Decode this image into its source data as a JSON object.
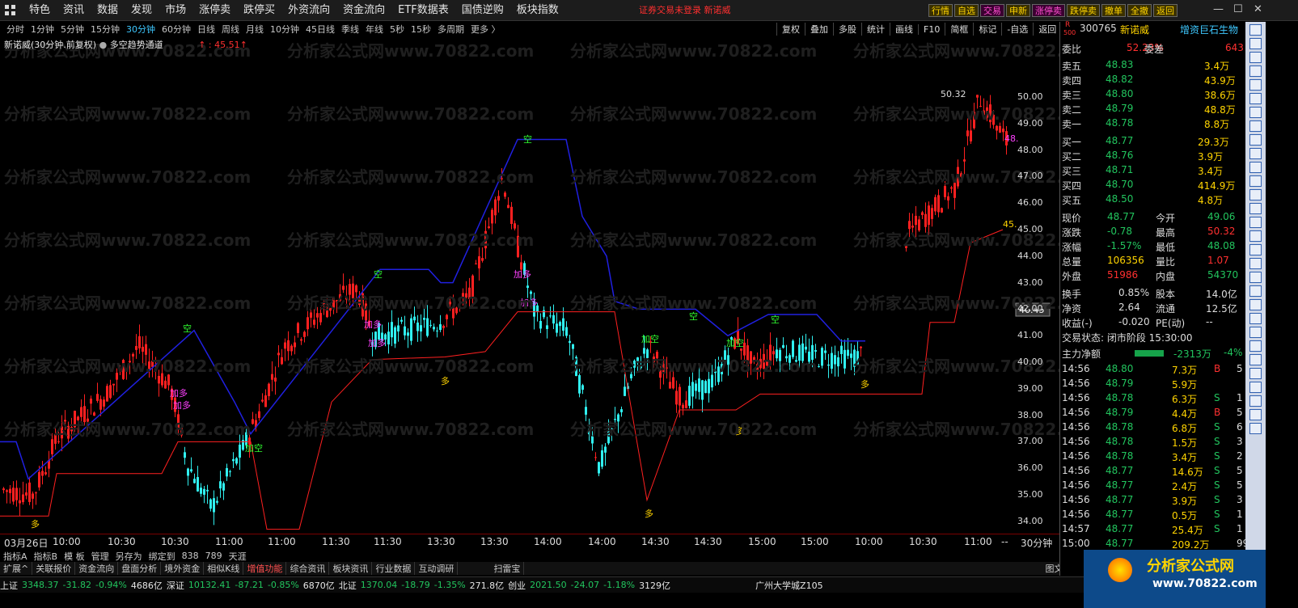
{
  "menu": [
    "特色",
    "资讯",
    "数据",
    "发现",
    "市场",
    "涨停卖",
    "跌停买",
    "外资流向",
    "资金流向",
    "ETF数据表",
    "国债逆购",
    "板块指数"
  ],
  "alert": "证券交易未登录  新诺威",
  "rbtns": [
    {
      "t": "行情",
      "c": "#ffd400"
    },
    {
      "t": "自选",
      "c": "#ffd400"
    },
    {
      "t": "交易",
      "c": "#ff4fd0"
    },
    {
      "t": "申新",
      "c": "#ffd400"
    },
    {
      "t": "涨停卖",
      "c": "#ff4fd0"
    },
    {
      "t": "跌停卖",
      "c": "#ffd400"
    },
    {
      "t": "撤单",
      "c": "#ffd400"
    },
    {
      "t": "全撤",
      "c": "#ffd400"
    },
    {
      "t": "返回",
      "c": "#ffd400"
    }
  ],
  "periods": [
    "分时",
    "1分钟",
    "5分钟",
    "15分钟",
    "30分钟",
    "60分钟",
    "日线",
    "周线",
    "月线",
    "10分钟",
    "45日线",
    "季线",
    "年线",
    "5秒",
    "15秒",
    "多周期",
    "更多 〉"
  ],
  "periodActive": "30分钟",
  "tools": [
    "复权",
    "叠加",
    "多股",
    "统计",
    "画线",
    "F10",
    "简框",
    "标记",
    "-自选",
    "返回"
  ],
  "chartinfo": {
    "name": "新诺威",
    "period": "(30分钟.前复权)",
    "indicator": "多空趋势通道",
    "value": "↑ : 45.51↑"
  },
  "yaxis": [
    "50.00",
    "49.00",
    "48.00",
    "47.00",
    "46.00",
    "45.00",
    "44.00",
    "43.00",
    "42.00",
    "41.00",
    "40.00",
    "39.00",
    "38.00",
    "37.00",
    "36.00",
    "35.00",
    "34.00"
  ],
  "xaxis": [
    "03月26日",
    "10:00",
    "10:30",
    "10:30",
    "11:00",
    "11:00",
    "11:30",
    "11:30",
    "13:30",
    "13:30",
    "14:00",
    "14:00",
    "14:30",
    "14:30",
    "15:00",
    "15:00",
    "10:00",
    "10:30",
    "11:00",
    "--",
    "30分钟"
  ],
  "markers": {
    "hi": "50.32",
    "lo": "33.07",
    "cur": "40.45",
    "kong": "空",
    "duo": "多",
    "jiaduo": "加多",
    "jiakong": "加空",
    "r48": "48.",
    "r45": "45."
  },
  "watermark": "分析家公式网www.70822.com",
  "tabs1": [
    "指标A",
    "指标B",
    "模 板",
    "管理",
    "另存为",
    "绑定到",
    "838",
    "789",
    "天涯"
  ],
  "tabs2": [
    "扩展^",
    "关联报价",
    "资金流向",
    "盘面分析",
    "境外资金",
    "相似K线",
    "增值功能",
    "综合资讯",
    "板块资讯",
    "行业数据",
    "互动调研",
    "扫雷宝",
    "图文F10",
    "侧边栏《",
    "笔",
    "价"
  ],
  "status": [
    {
      "n": "上证",
      "v": "3348.37",
      "d": "-31.82",
      "p": "-0.94%",
      "a": "4686亿"
    },
    {
      "n": "深证",
      "v": "10132.41",
      "d": "-87.21",
      "p": "-0.85%",
      "a": "6870亿"
    },
    {
      "n": "北证",
      "v": "1370.04",
      "d": "-18.79",
      "p": "-1.35%",
      "a": "271.8亿"
    },
    {
      "n": "创业",
      "v": "2021.50",
      "d": "-24.07",
      "p": "-1.18%",
      "a": "3129亿"
    }
  ],
  "statusRight": "广州大学城Z105",
  "stock": {
    "code": "300765",
    "name": "新诺威",
    "tag": "增资巨石生物",
    "r": "R",
    "five": "500"
  },
  "quote": {
    "weibi": "52.23%",
    "weicha": "643",
    "sell": [
      [
        "卖五",
        "48.83",
        "3.4万"
      ],
      [
        "卖四",
        "48.82",
        "43.9万"
      ],
      [
        "卖三",
        "48.80",
        "38.6万"
      ],
      [
        "卖二",
        "48.79",
        "48.8万"
      ],
      [
        "卖一",
        "48.78",
        "8.8万"
      ]
    ],
    "buy": [
      [
        "买一",
        "48.77",
        "29.3万"
      ],
      [
        "买二",
        "48.76",
        "3.9万"
      ],
      [
        "买三",
        "48.71",
        "3.4万"
      ],
      [
        "买四",
        "48.70",
        "414.9万"
      ],
      [
        "买五",
        "48.50",
        "4.8万"
      ]
    ],
    "stats": [
      [
        "现价",
        "48.77",
        "今开",
        "49.06"
      ],
      [
        "涨跌",
        "-0.78",
        "最高",
        "50.32"
      ],
      [
        "涨幅",
        "-1.57%",
        "最低",
        "48.08"
      ],
      [
        "总量",
        "106356",
        "量比",
        "1.07"
      ],
      [
        "外盘",
        "51986",
        "内盘",
        "54370"
      ]
    ],
    "stats2": [
      [
        "换手",
        "0.85%",
        "股本",
        "14.0亿"
      ],
      [
        "净资",
        "2.64",
        "流通",
        "12.5亿"
      ],
      [
        "收益(-)",
        "-0.020",
        "PE(动)",
        "--"
      ]
    ],
    "tradeState": "交易状态: 闭市阶段 15:30:00",
    "netflow": "主力净额",
    "netVal": "-2313万",
    "netPct": "-4%",
    "ticks": [
      [
        "14:56",
        "48.80",
        "7.3万",
        "B",
        "5"
      ],
      [
        "14:56",
        "48.79",
        "5.9万",
        "",
        ""
      ],
      [
        "14:56",
        "48.78",
        "6.3万",
        "S",
        "1"
      ],
      [
        "14:56",
        "48.79",
        "4.4万",
        "B",
        "5"
      ],
      [
        "14:56",
        "48.78",
        "6.8万",
        "S",
        "6"
      ],
      [
        "14:56",
        "48.78",
        "1.5万",
        "S",
        "3"
      ],
      [
        "14:56",
        "48.78",
        "3.4万",
        "S",
        "2"
      ],
      [
        "14:56",
        "48.77",
        "14.6万",
        "S",
        "5"
      ],
      [
        "14:56",
        "48.77",
        "2.4万",
        "S",
        "5"
      ],
      [
        "14:56",
        "48.77",
        "3.9万",
        "S",
        "3"
      ],
      [
        "14:56",
        "48.77",
        "0.5万",
        "S",
        "1"
      ],
      [
        "14:57",
        "48.77",
        "25.4万",
        "S",
        "1"
      ],
      [
        "15:00",
        "48.77",
        "209.2万",
        "",
        "99"
      ]
    ]
  },
  "ad": {
    "name": "分析家公式网",
    "url": "www.70822.com"
  }
}
